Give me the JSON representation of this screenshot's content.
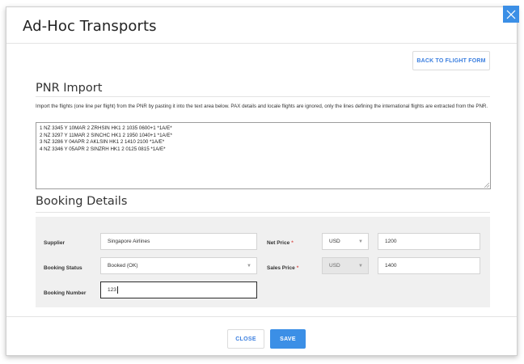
{
  "modal": {
    "title": "Ad-Hoc Transports",
    "back_button_label": "BACK TO FLIGHT FORM"
  },
  "pnr": {
    "section_title": "PNR Import",
    "description": "Import the flights (one line per flight) from the PNR by pasting it into the text area below. PAX details and locale flights are ignored, only the lines defining the international flights are extracted from the PNR.",
    "lines": [
      "1 NZ 3345 Y 10MAR 2 ZRHSIN HK1 2 1035 0600+1 *1A/E*",
      "2 NZ 3297 Y 11MAR 2 SINCHC HK1 2 1950 1040+1 *1A/E*",
      "3 NZ 3286 Y 04APR 2 AKLSIN HK1 2 1410 2100 *1A/E*",
      "4 NZ 3346 Y 05APR 2 SINZRH HK1 2 0125 0815 *1A/E*"
    ]
  },
  "booking": {
    "section_title": "Booking Details",
    "supplier_label": "Supplier",
    "supplier_value": "Singapore Airlines",
    "status_label": "Booking Status",
    "status_value": "Booked (OK)",
    "number_label": "Booking Number",
    "number_value": "123",
    "net_price_label": "Net Price",
    "net_currency": "USD",
    "net_amount": "1200",
    "sales_price_label": "Sales Price",
    "sales_currency": "USD",
    "sales_amount": "1400",
    "required_marker": "*"
  },
  "footer": {
    "close_label": "CLOSE",
    "save_label": "SAVE"
  },
  "colors": {
    "accent": "#3b8fe6",
    "link": "#3b7fe0",
    "required": "#d9534f",
    "panel_bg": "#f0f0f0"
  },
  "icons": {
    "close": "close-icon",
    "select_caret": "chevron-down-icon",
    "resize": "resize-grip-icon"
  }
}
